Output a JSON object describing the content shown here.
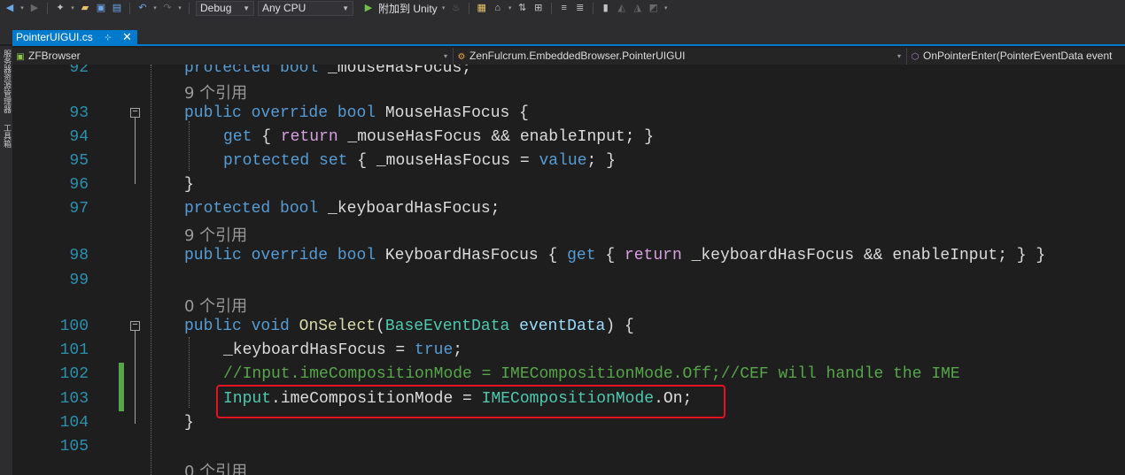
{
  "toolbar": {
    "config": "Debug",
    "platform": "Any CPU",
    "run_label": "附加到 Unity"
  },
  "tab": {
    "filename": "PointerUIGUI.cs",
    "pin_glyph": "⊹",
    "close_glyph": "✕"
  },
  "sidebar": {
    "vertical_text_1": "服务器资源管理器",
    "vertical_text_2": "工具箱"
  },
  "nav": {
    "project": "ZFBrowser",
    "class_path": "ZenFulcrum.EmbeddedBrowser.PointerUIGUI",
    "member": "OnPointerEnter(PointerEventData event"
  },
  "editor": {
    "line_numbers": [
      "92",
      "93",
      "94",
      "95",
      "96",
      "97",
      "98",
      "99",
      "100",
      "101",
      "102",
      "103",
      "104",
      "105"
    ],
    "lens": {
      "l92": "9 个引用",
      "l97": "9 个引用",
      "l99": "0 个引用",
      "l105": "0 个引用"
    },
    "tokens": {
      "l92": [
        "protected",
        " ",
        "bool",
        " _mouseHasFocus;"
      ],
      "l93": [
        "public",
        " ",
        "override",
        " ",
        "bool",
        " MouseHasFocus {"
      ],
      "l94": [
        "get",
        " { ",
        "return",
        " _mouseHasFocus && enableInput; }"
      ],
      "l95": [
        "protected",
        " ",
        "set",
        " { _mouseHasFocus = ",
        "value",
        "; }"
      ],
      "l96": [
        "}"
      ],
      "l97": [
        "protected",
        " ",
        "bool",
        " _keyboardHasFocus;"
      ],
      "l98": [
        "public",
        " ",
        "override",
        " ",
        "bool",
        " KeyboardHasFocus { ",
        "get",
        " { ",
        "return",
        " _keyboardHasFocus && enableInput; } }"
      ],
      "l100": [
        "public",
        " ",
        "void",
        " ",
        "OnSelect",
        "(",
        "BaseEventData",
        " ",
        "eventData",
        ") {"
      ],
      "l101": [
        "_keyboardHasFocus = ",
        "true",
        ";"
      ],
      "l102": [
        "//Input.imeCompositionMode = IMECompositionMode.Off;//CEF will handle the IME"
      ],
      "l103": [
        "Input",
        ".imeCompositionMode = ",
        "IMECompositionMode",
        ".On;"
      ],
      "l104": [
        "}"
      ]
    }
  },
  "colors": {
    "accent": "#007acc",
    "keyword": "#569cd6",
    "type": "#4ec9b0",
    "comment": "#57a64a",
    "control": "#d8a0df",
    "highlight_box": "#e81123"
  },
  "icons": [
    "back-icon",
    "forward-icon",
    "new-project-icon",
    "open-icon",
    "save-icon",
    "save-all-icon",
    "undo-icon",
    "redo-icon",
    "play-icon",
    "bookmark-icon"
  ]
}
